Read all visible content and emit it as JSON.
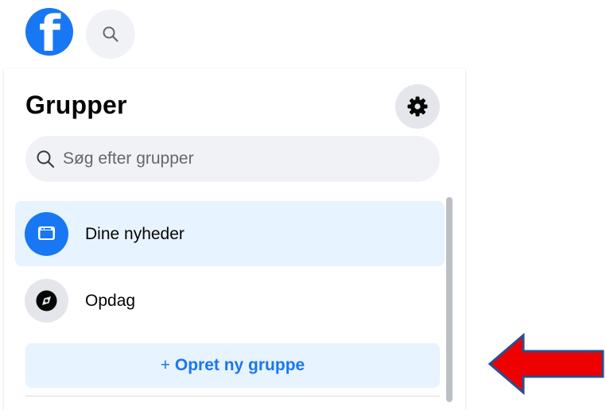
{
  "header": {
    "logo_letter": "f",
    "logo_icon": "facebook-logo-icon",
    "search_icon": "search-icon"
  },
  "sidebar": {
    "title": "Grupper",
    "settings_icon": "gear-icon",
    "search": {
      "placeholder": "Søg efter grupper"
    },
    "items": [
      {
        "label": "Dine nyheder",
        "icon": "feed-icon",
        "active": true
      },
      {
        "label": "Opdag",
        "icon": "compass-icon",
        "active": false
      }
    ],
    "create_button": {
      "plus": "+",
      "label": "Opret ny gruppe"
    }
  },
  "annotation": {
    "icon": "red-arrow-left-icon",
    "color": "#ee0000"
  },
  "colors": {
    "brand": "#1877f2",
    "active_bg": "#e7f3ff",
    "search_bg": "#f0f2f5"
  }
}
